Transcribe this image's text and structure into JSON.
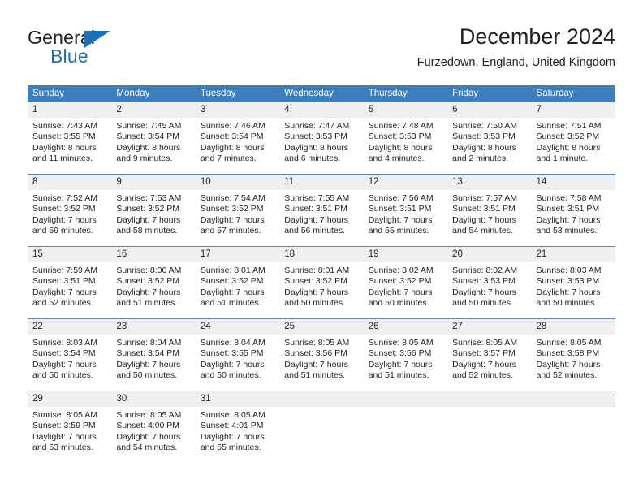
{
  "brand": {
    "name_part1": "General",
    "name_part2": "Blue",
    "accent_color": "#1d70b8",
    "triangle_icon": "blue-triangle-icon"
  },
  "header": {
    "title": "December 2024",
    "subtitle": "Furzedown, England, United Kingdom"
  },
  "calendar": {
    "header_bg": "#3d7ebf",
    "daynum_bg": "#efefef",
    "weekdays": [
      "Sunday",
      "Monday",
      "Tuesday",
      "Wednesday",
      "Thursday",
      "Friday",
      "Saturday"
    ],
    "weeks": [
      [
        {
          "day": "1",
          "lines": [
            "Sunrise: 7:43 AM",
            "Sunset: 3:55 PM",
            "Daylight: 8 hours",
            "and 11 minutes."
          ]
        },
        {
          "day": "2",
          "lines": [
            "Sunrise: 7:45 AM",
            "Sunset: 3:54 PM",
            "Daylight: 8 hours",
            "and 9 minutes."
          ]
        },
        {
          "day": "3",
          "lines": [
            "Sunrise: 7:46 AM",
            "Sunset: 3:54 PM",
            "Daylight: 8 hours",
            "and 7 minutes."
          ]
        },
        {
          "day": "4",
          "lines": [
            "Sunrise: 7:47 AM",
            "Sunset: 3:53 PM",
            "Daylight: 8 hours",
            "and 6 minutes."
          ]
        },
        {
          "day": "5",
          "lines": [
            "Sunrise: 7:48 AM",
            "Sunset: 3:53 PM",
            "Daylight: 8 hours",
            "and 4 minutes."
          ]
        },
        {
          "day": "6",
          "lines": [
            "Sunrise: 7:50 AM",
            "Sunset: 3:53 PM",
            "Daylight: 8 hours",
            "and 2 minutes."
          ]
        },
        {
          "day": "7",
          "lines": [
            "Sunrise: 7:51 AM",
            "Sunset: 3:52 PM",
            "Daylight: 8 hours",
            "and 1 minute."
          ]
        }
      ],
      [
        {
          "day": "8",
          "lines": [
            "Sunrise: 7:52 AM",
            "Sunset: 3:52 PM",
            "Daylight: 7 hours",
            "and 59 minutes."
          ]
        },
        {
          "day": "9",
          "lines": [
            "Sunrise: 7:53 AM",
            "Sunset: 3:52 PM",
            "Daylight: 7 hours",
            "and 58 minutes."
          ]
        },
        {
          "day": "10",
          "lines": [
            "Sunrise: 7:54 AM",
            "Sunset: 3:52 PM",
            "Daylight: 7 hours",
            "and 57 minutes."
          ]
        },
        {
          "day": "11",
          "lines": [
            "Sunrise: 7:55 AM",
            "Sunset: 3:51 PM",
            "Daylight: 7 hours",
            "and 56 minutes."
          ]
        },
        {
          "day": "12",
          "lines": [
            "Sunrise: 7:56 AM",
            "Sunset: 3:51 PM",
            "Daylight: 7 hours",
            "and 55 minutes."
          ]
        },
        {
          "day": "13",
          "lines": [
            "Sunrise: 7:57 AM",
            "Sunset: 3:51 PM",
            "Daylight: 7 hours",
            "and 54 minutes."
          ]
        },
        {
          "day": "14",
          "lines": [
            "Sunrise: 7:58 AM",
            "Sunset: 3:51 PM",
            "Daylight: 7 hours",
            "and 53 minutes."
          ]
        }
      ],
      [
        {
          "day": "15",
          "lines": [
            "Sunrise: 7:59 AM",
            "Sunset: 3:51 PM",
            "Daylight: 7 hours",
            "and 52 minutes."
          ]
        },
        {
          "day": "16",
          "lines": [
            "Sunrise: 8:00 AM",
            "Sunset: 3:52 PM",
            "Daylight: 7 hours",
            "and 51 minutes."
          ]
        },
        {
          "day": "17",
          "lines": [
            "Sunrise: 8:01 AM",
            "Sunset: 3:52 PM",
            "Daylight: 7 hours",
            "and 51 minutes."
          ]
        },
        {
          "day": "18",
          "lines": [
            "Sunrise: 8:01 AM",
            "Sunset: 3:52 PM",
            "Daylight: 7 hours",
            "and 50 minutes."
          ]
        },
        {
          "day": "19",
          "lines": [
            "Sunrise: 8:02 AM",
            "Sunset: 3:52 PM",
            "Daylight: 7 hours",
            "and 50 minutes."
          ]
        },
        {
          "day": "20",
          "lines": [
            "Sunrise: 8:02 AM",
            "Sunset: 3:53 PM",
            "Daylight: 7 hours",
            "and 50 minutes."
          ]
        },
        {
          "day": "21",
          "lines": [
            "Sunrise: 8:03 AM",
            "Sunset: 3:53 PM",
            "Daylight: 7 hours",
            "and 50 minutes."
          ]
        }
      ],
      [
        {
          "day": "22",
          "lines": [
            "Sunrise: 8:03 AM",
            "Sunset: 3:54 PM",
            "Daylight: 7 hours",
            "and 50 minutes."
          ]
        },
        {
          "day": "23",
          "lines": [
            "Sunrise: 8:04 AM",
            "Sunset: 3:54 PM",
            "Daylight: 7 hours",
            "and 50 minutes."
          ]
        },
        {
          "day": "24",
          "lines": [
            "Sunrise: 8:04 AM",
            "Sunset: 3:55 PM",
            "Daylight: 7 hours",
            "and 50 minutes."
          ]
        },
        {
          "day": "25",
          "lines": [
            "Sunrise: 8:05 AM",
            "Sunset: 3:56 PM",
            "Daylight: 7 hours",
            "and 51 minutes."
          ]
        },
        {
          "day": "26",
          "lines": [
            "Sunrise: 8:05 AM",
            "Sunset: 3:56 PM",
            "Daylight: 7 hours",
            "and 51 minutes."
          ]
        },
        {
          "day": "27",
          "lines": [
            "Sunrise: 8:05 AM",
            "Sunset: 3:57 PM",
            "Daylight: 7 hours",
            "and 52 minutes."
          ]
        },
        {
          "day": "28",
          "lines": [
            "Sunrise: 8:05 AM",
            "Sunset: 3:58 PM",
            "Daylight: 7 hours",
            "and 52 minutes."
          ]
        }
      ],
      [
        {
          "day": "29",
          "lines": [
            "Sunrise: 8:05 AM",
            "Sunset: 3:59 PM",
            "Daylight: 7 hours",
            "and 53 minutes."
          ]
        },
        {
          "day": "30",
          "lines": [
            "Sunrise: 8:05 AM",
            "Sunset: 4:00 PM",
            "Daylight: 7 hours",
            "and 54 minutes."
          ]
        },
        {
          "day": "31",
          "lines": [
            "Sunrise: 8:05 AM",
            "Sunset: 4:01 PM",
            "Daylight: 7 hours",
            "and 55 minutes."
          ]
        },
        {
          "day": "",
          "lines": [
            "",
            "",
            "",
            ""
          ]
        },
        {
          "day": "",
          "lines": [
            "",
            "",
            "",
            ""
          ]
        },
        {
          "day": "",
          "lines": [
            "",
            "",
            "",
            ""
          ]
        },
        {
          "day": "",
          "lines": [
            "",
            "",
            "",
            ""
          ]
        }
      ]
    ]
  }
}
